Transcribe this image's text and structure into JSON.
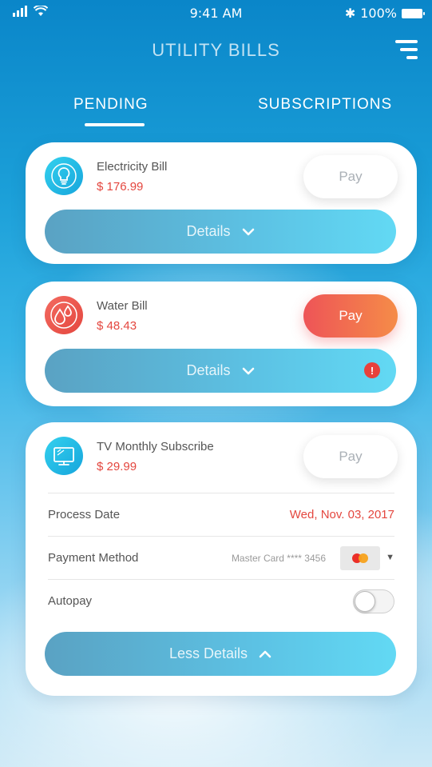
{
  "status_bar": {
    "time": "9:41 AM",
    "battery": "100%"
  },
  "header": {
    "title": "UTILITY BILLS"
  },
  "tabs": [
    {
      "label": "PENDING",
      "active": true
    },
    {
      "label": "SUBSCRIPTIONS",
      "active": false
    }
  ],
  "bills": [
    {
      "name": "Electricity Bill",
      "amount": "$ 176.99",
      "pay_label": "Pay",
      "details_label": "Details",
      "icon": "lightbulb-icon"
    },
    {
      "name": "Water Bill",
      "amount": "$ 48.43",
      "pay_label": "Pay",
      "details_label": "Details",
      "icon": "water-drop-icon",
      "alert": "!"
    },
    {
      "name": "TV Monthly Subscribe",
      "amount": "$ 29.99",
      "pay_label": "Pay",
      "details_label": "Less Details",
      "icon": "tv-icon",
      "process_date_label": "Process Date",
      "process_date_value": "Wed, Nov. 03, 2017",
      "payment_method_label": "Payment Method",
      "payment_method_value": "Master Card  **** 3456",
      "autopay_label": "Autopay",
      "autopay_on": false
    }
  ],
  "colors": {
    "accent_red": "#e4473f",
    "accent_blue": "#16a5dc",
    "pay_gradient_start": "#ee5457",
    "pay_gradient_end": "#f58c48"
  }
}
